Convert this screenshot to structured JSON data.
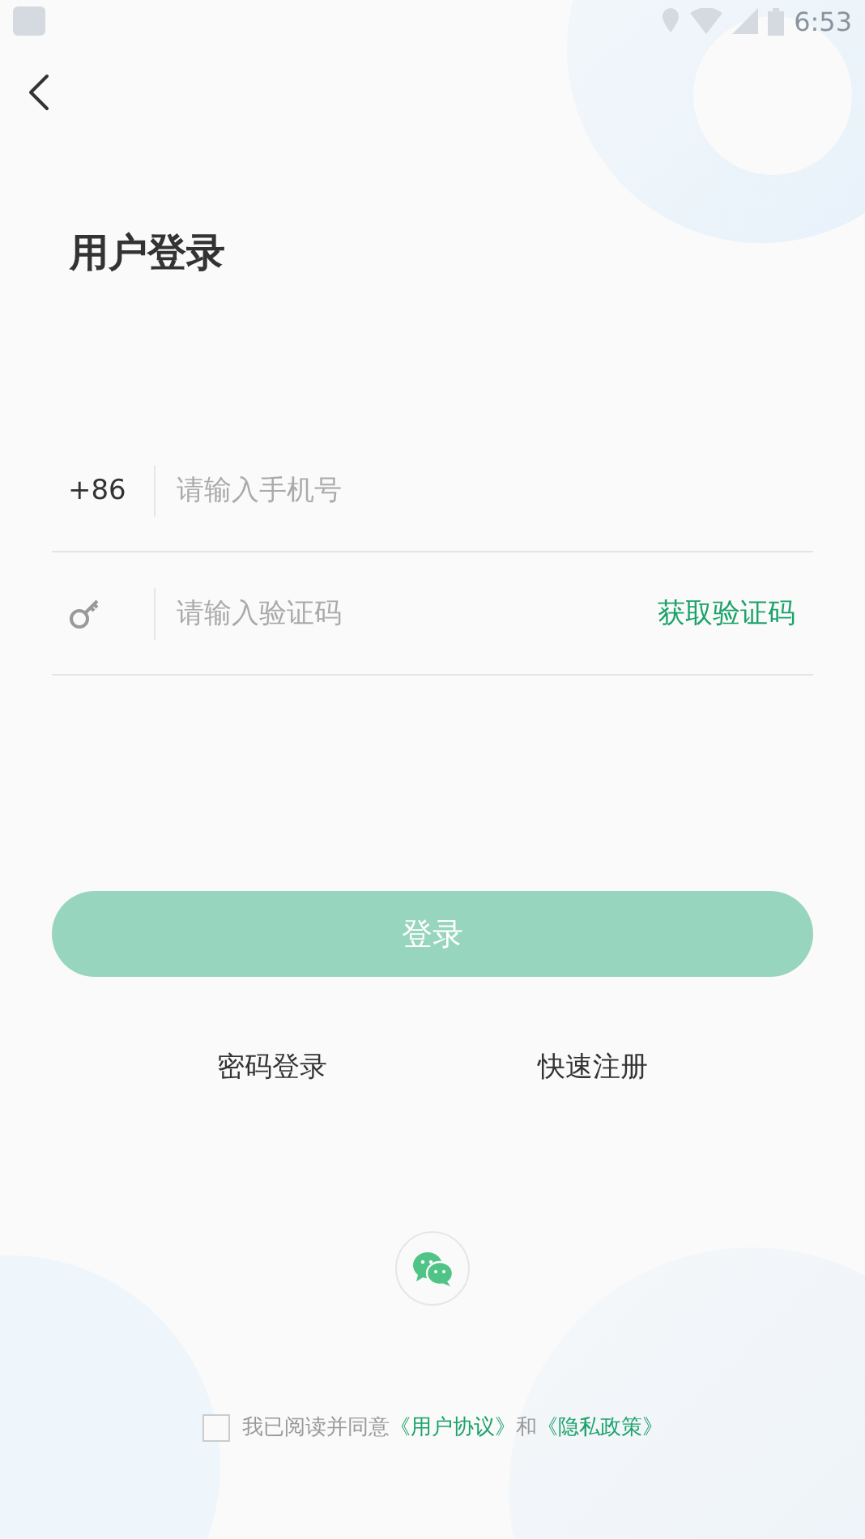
{
  "status_bar": {
    "time": "6:53"
  },
  "title": "用户登录",
  "phone": {
    "prefix": "+86",
    "placeholder": "请输入手机号"
  },
  "code": {
    "placeholder": "请输入验证码",
    "action": "获取验证码"
  },
  "login_button": {
    "label": "登录",
    "disabled": true
  },
  "links": [
    "密码登录",
    "快速注册"
  ],
  "agreement": {
    "checked": false,
    "text": "我已阅读并同意",
    "link1": "《用户协议》",
    "joiner": "和",
    "link2": "《隐私政策》"
  }
}
